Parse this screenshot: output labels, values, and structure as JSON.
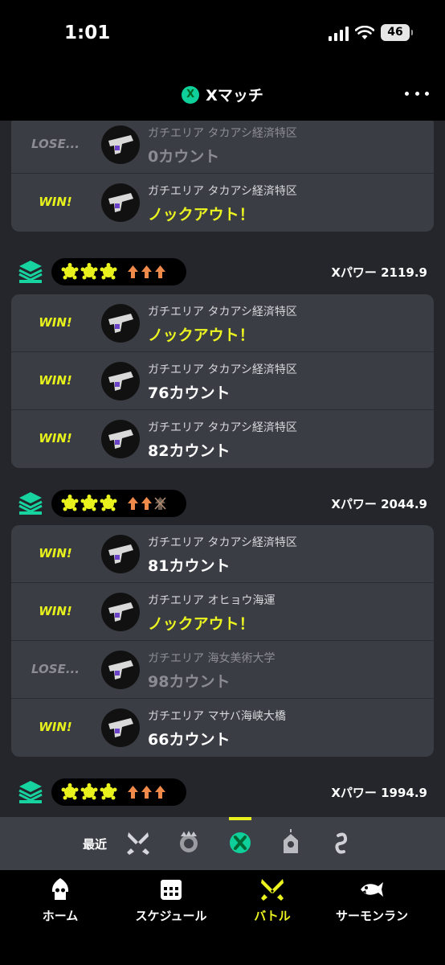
{
  "status_bar": {
    "time": "1:01",
    "battery": "46"
  },
  "header": {
    "title": "Xマッチ"
  },
  "colors": {
    "win": "#e7f21c",
    "lose": "#8b8d93",
    "accent": "#0fcf9a",
    "card": "#3a3d44"
  },
  "battle_sets": [
    {
      "x_power": "",
      "battles": [
        {
          "result": "LOSE...",
          "mode": "ガチエリア タカアシ経済特区",
          "score": "0カウント"
        },
        {
          "result": "WIN!",
          "mode": "ガチエリア タカアシ経済特区",
          "score": "ノックアウト！"
        }
      ]
    },
    {
      "x_power": "Xパワー 2119.9",
      "battles": [
        {
          "result": "WIN!",
          "mode": "ガチエリア タカアシ経済特区",
          "score": "ノックアウト！"
        },
        {
          "result": "WIN!",
          "mode": "ガチエリア タカアシ経済特区",
          "score": "76カウント"
        },
        {
          "result": "WIN!",
          "mode": "ガチエリア タカアシ経済特区",
          "score": "82カウント"
        }
      ]
    },
    {
      "x_power": "Xパワー 2044.9",
      "battles": [
        {
          "result": "WIN!",
          "mode": "ガチエリア タカアシ経済特区",
          "score": "81カウント"
        },
        {
          "result": "WIN!",
          "mode": "ガチエリア オヒョウ海運",
          "score": "ノックアウト！"
        },
        {
          "result": "LOSE...",
          "mode": "ガチエリア 海女美術大学",
          "score": "98カウント"
        },
        {
          "result": "WIN!",
          "mode": "ガチエリア マサバ海峡大橋",
          "score": "66カウント"
        }
      ]
    },
    {
      "x_power": "Xパワー 1994.9",
      "battles": []
    }
  ],
  "filter": {
    "label": "最近",
    "icons": [
      "regular-battle-icon",
      "bankara-battle-icon",
      "x-battle-icon",
      "event-battle-icon",
      "private-battle-icon"
    ],
    "selected": "x-battle-icon"
  },
  "tabs": [
    {
      "label": "ホーム",
      "icon": "squid-home-icon"
    },
    {
      "label": "スケジュール",
      "icon": "calendar-icon"
    },
    {
      "label": "バトル",
      "icon": "battle-icon",
      "active": true
    },
    {
      "label": "サーモンラン",
      "icon": "salmon-icon"
    }
  ]
}
